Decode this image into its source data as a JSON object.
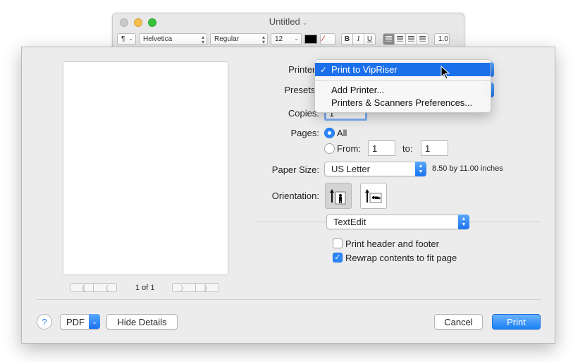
{
  "bg_window": {
    "title": "Untitled",
    "toolbar": {
      "paragraph_style": "¶",
      "font_family": "Helvetica",
      "font_style": "Regular",
      "font_size": "12",
      "bold": "B",
      "italic": "I",
      "underline": "U",
      "line_spacing": "1.0",
      "text_color": "#000000"
    }
  },
  "dialog": {
    "printer_label": "Printer:",
    "presets_label": "Presets:",
    "copies_label": "Copies:",
    "copies_value": "1",
    "pages_label": "Pages:",
    "pages_all": "All",
    "pages_from": "From:",
    "pages_from_value": "1",
    "pages_to": "to:",
    "pages_to_value": "1",
    "paper_size_label": "Paper Size:",
    "paper_size_value": "US Letter",
    "paper_dimensions": "8.50 by 11.00 inches",
    "orientation_label": "Orientation:",
    "app_section": "TextEdit",
    "print_header_footer": "Print header and footer",
    "print_header_footer_checked": false,
    "rewrap_contents": "Rewrap contents to fit page",
    "rewrap_contents_checked": true,
    "page_indicator": "1 of 1",
    "page_nav": {
      "first": "《",
      "prev": "〈",
      "next": "〉",
      "last": "》"
    },
    "help": "?",
    "pdf_button": "PDF",
    "hide_details_button": "Hide Details",
    "cancel_button": "Cancel",
    "print_button": "Print"
  },
  "printer_menu": {
    "selected_check": "✓",
    "items": [
      "Print to VipRiser",
      "Add Printer...",
      "Printers & Scanners Preferences..."
    ]
  },
  "colors": {
    "accent": "#2c86f6",
    "menu_highlight": "#1c6fea",
    "sheet_bg": "#ececec"
  }
}
